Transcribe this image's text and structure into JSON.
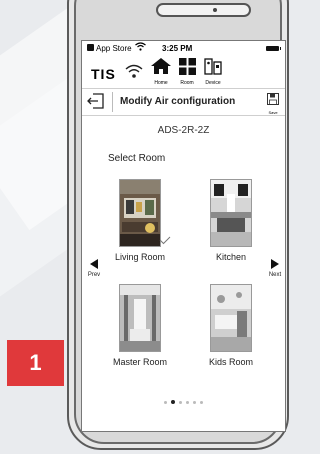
{
  "step_badge": "1",
  "status_bar": {
    "carrier": "App Store",
    "time": "3:25 PM"
  },
  "brand": {
    "logo": "TIS",
    "nav": [
      {
        "label": "Home",
        "icon": "home-icon"
      },
      {
        "label": "Room",
        "icon": "grid-icon"
      },
      {
        "label": "Device",
        "icon": "device-icon"
      }
    ]
  },
  "header": {
    "title": "Modify Air configuration",
    "save_label": "Save"
  },
  "device_name": "ADS-2R-2Z",
  "select_room_label": "Select Room",
  "rooms": [
    {
      "label": "Living Room",
      "selected": true
    },
    {
      "label": "Kitchen",
      "selected": false
    },
    {
      "label": "Master Room",
      "selected": false
    },
    {
      "label": "Kids Room",
      "selected": false
    }
  ],
  "pager": {
    "prev_label": "Prev",
    "next_label": "Next",
    "pages": 6,
    "active_page": 2
  },
  "colors": {
    "badge": "#e0393b",
    "background": "#e9ebee"
  }
}
